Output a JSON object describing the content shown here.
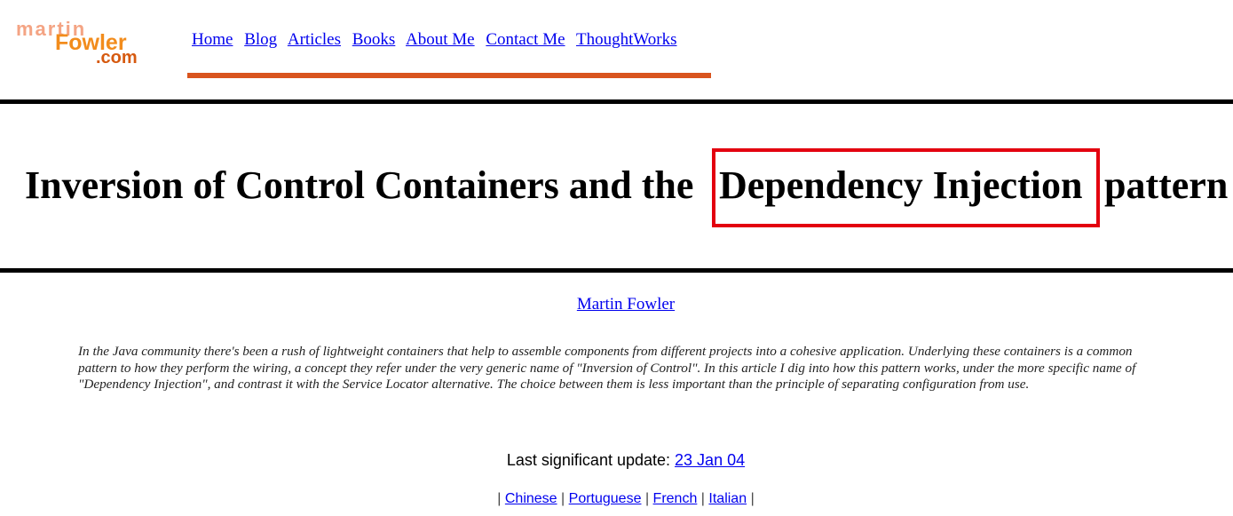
{
  "logo": {
    "line1": "martin",
    "line2": "Fowler",
    "line3": ".com"
  },
  "nav": {
    "items": [
      {
        "label": "Home"
      },
      {
        "label": "Blog"
      },
      {
        "label": "Articles"
      },
      {
        "label": "Books"
      },
      {
        "label": "About Me"
      },
      {
        "label": "Contact Me"
      },
      {
        "label": "ThoughtWorks"
      }
    ]
  },
  "article": {
    "title_part1": "Inversion of Control Containers and the",
    "title_highlight": "Dependency Injection",
    "title_part2": "pattern",
    "author": "Martin Fowler",
    "abstract": "In the Java community there's been a rush of lightweight containers that help to assemble components from different projects into a cohesive application. Underlying these containers is a common pattern to how they perform the wiring, a concept they refer under the very generic name of \"Inversion of Control\". In this article I dig into how this pattern works, under the more specific name of \"Dependency Injection\", and contrast it with the Service Locator alternative. The choice between them is less important than the principle of separating configuration from use.",
    "update_label": "Last significant update:",
    "update_date": "23 Jan 04"
  },
  "translations": {
    "separator": "|",
    "items": [
      {
        "label": "Chinese"
      },
      {
        "label": "Portuguese"
      },
      {
        "label": "French"
      },
      {
        "label": "Italian"
      }
    ]
  },
  "colors": {
    "nav_bar": "#d9541e",
    "highlight_border": "#e3000f",
    "link": "#0000ee"
  }
}
